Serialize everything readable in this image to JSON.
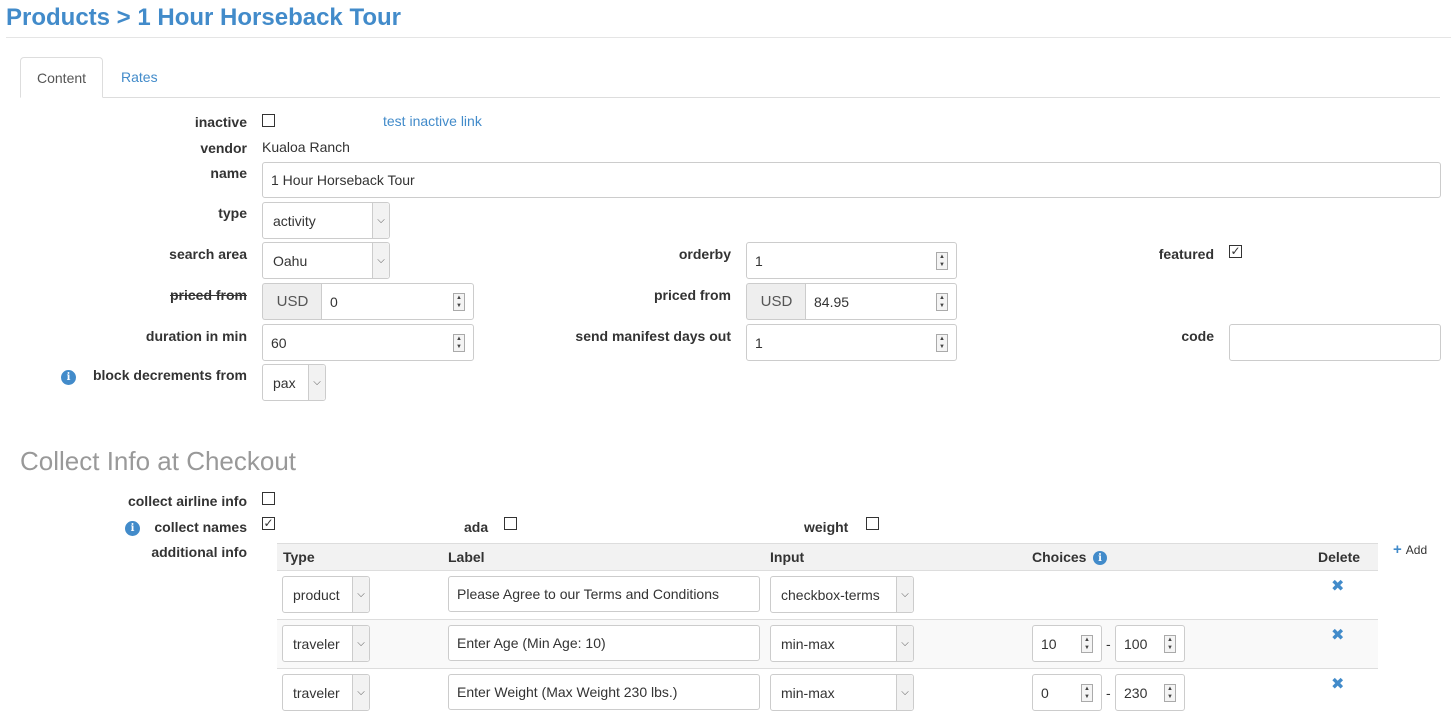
{
  "page": {
    "title": "Products > 1 Hour Horseback Tour"
  },
  "tabs": [
    {
      "label": "Content",
      "active": true
    },
    {
      "label": "Rates",
      "active": false
    }
  ],
  "form": {
    "inactive": {
      "label": "inactive",
      "checked": false,
      "link": "test inactive link"
    },
    "vendor": {
      "label": "vendor",
      "value": "Kualoa Ranch"
    },
    "name": {
      "label": "name",
      "value": "1 Hour Horseback Tour"
    },
    "type": {
      "label": "type",
      "value": "activity"
    },
    "search_area": {
      "label": "search area",
      "value": "Oahu"
    },
    "orderby": {
      "label": "orderby",
      "value": "1"
    },
    "featured": {
      "label": "featured",
      "checked": true
    },
    "priced_from_old": {
      "label": "priced from",
      "currency": "USD",
      "value": "0"
    },
    "priced_from": {
      "label": "priced from",
      "currency": "USD",
      "value": "84.95"
    },
    "duration": {
      "label": "duration in min",
      "value": "60"
    },
    "manifest": {
      "label": "send manifest days out",
      "value": "1"
    },
    "code": {
      "label": "code",
      "value": ""
    },
    "block_decrements": {
      "label": "block decrements from",
      "value": "pax"
    }
  },
  "checkout": {
    "title": "Collect Info at Checkout",
    "airline": {
      "label": "collect airline info",
      "checked": false
    },
    "names": {
      "label": "collect names",
      "checked": true
    },
    "ada": {
      "label": "ada",
      "checked": false
    },
    "weight": {
      "label": "weight",
      "checked": false
    },
    "additional_label": "additional info",
    "add_label": "Add",
    "headers": {
      "type": "Type",
      "label": "Label",
      "input": "Input",
      "choices": "Choices",
      "delete": "Delete"
    },
    "rows": [
      {
        "type": "product",
        "label": "Please Agree to our Terms and Conditions",
        "input": "checkbox-terms",
        "min": "",
        "max": ""
      },
      {
        "type": "traveler",
        "label": "Enter Age (Min Age: 10)",
        "input": "min-max",
        "min": "10",
        "max": "100"
      },
      {
        "type": "traveler",
        "label": "Enter Weight (Max Weight 230 lbs.)",
        "input": "min-max",
        "min": "0",
        "max": "230"
      }
    ]
  },
  "icons": {
    "check": "✓",
    "caret": "⌵",
    "delete": "✖",
    "plus": "+",
    "info": "i"
  },
  "colors": {
    "primary": "#428bca",
    "muted_heading": "#999999"
  }
}
